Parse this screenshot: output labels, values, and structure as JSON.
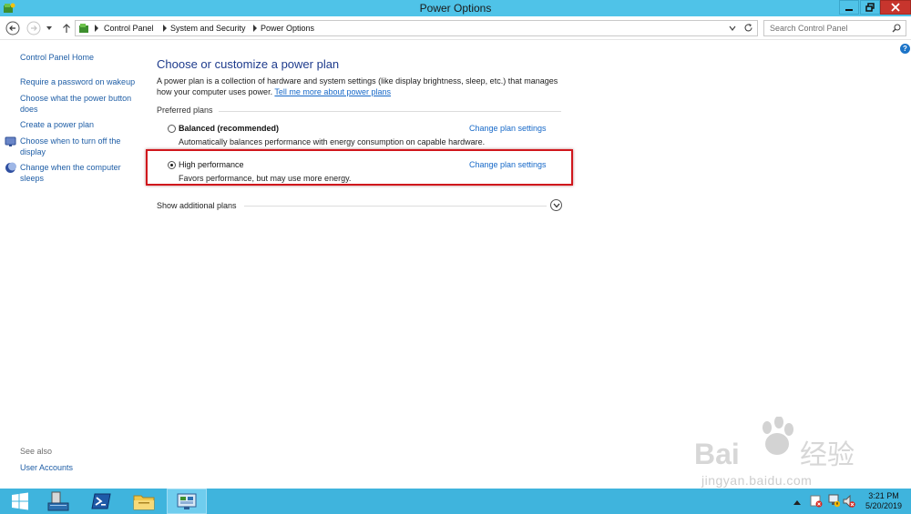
{
  "window": {
    "title": "Power Options"
  },
  "addressbar": {
    "breadcrumbs": [
      "Control Panel",
      "System and Security",
      "Power Options"
    ],
    "search_placeholder": "Search Control Panel"
  },
  "sidebar": {
    "home": "Control Panel Home",
    "links": [
      "Require a password on wakeup",
      "Choose what the power button does",
      "Create a power plan",
      "Choose when to turn off the display",
      "Change when the computer sleeps"
    ],
    "see_also_label": "See also",
    "see_also_links": [
      "User Accounts"
    ]
  },
  "main": {
    "title": "Choose or customize a power plan",
    "description": "A power plan is a collection of hardware and system settings (like display brightness, sleep, etc.) that manages how your computer uses power.",
    "description_link": "Tell me more about power plans",
    "preferred_plans_heading": "Preferred plans",
    "plans": [
      {
        "name": "Balanced (recommended)",
        "description": "Automatically balances performance with energy consumption on capable hardware.",
        "link": "Change plan settings",
        "selected": false
      },
      {
        "name": "High performance",
        "description": "Favors performance, but may use more energy.",
        "link": "Change plan settings",
        "selected": true
      }
    ],
    "show_additional": "Show additional plans"
  },
  "taskbar": {
    "time": "3:21 PM",
    "date": "5/20/2019"
  },
  "watermark": {
    "text": "jingyan.baidu.com"
  },
  "colors": {
    "titlebar": "#4fc3e8",
    "taskbar": "#3fb4dd",
    "link": "#1668c8",
    "highlight": "#d0161c"
  }
}
